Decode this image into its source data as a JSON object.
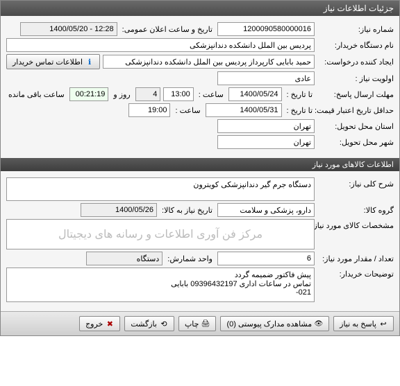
{
  "window": {
    "title": "جزئیات اطلاعات نیاز"
  },
  "need": {
    "number_label": "شماره نیاز:",
    "number": "1200090580000016",
    "announce_label": "تاریخ و ساعت اعلان عمومی:",
    "announce": "12:28 - 1400/05/20",
    "buyer_label": "نام دستگاه خریدار:",
    "buyer": "پردیس بین الملل دانشکده دندانپزشکی",
    "creator_label": "ایجاد کننده درخواست:",
    "creator": "حمید بابایی کارپرداز پردیس بین الملل دانشکده دندانپزشکی",
    "contact_btn": "اطلاعات تماس خریدار",
    "priority_label": "اولویت نیاز :",
    "priority": "عادی",
    "deadline_reply_label": "مهلت ارسال پاسخ:",
    "to_date_label": "تا تاریخ :",
    "deadline_date": "1400/05/24",
    "time_label": "ساعت :",
    "deadline_time": "13:00",
    "days": "4",
    "days_label": "روز و",
    "remain_time": "00:21:19",
    "remain_label": "ساعت باقی مانده",
    "min_valid_label": "حداقل تاریخ اعتبار قیمت:",
    "min_valid_date": "1400/05/31",
    "min_valid_time": "19:00",
    "province_label": "استان محل تحویل:",
    "province": "تهران",
    "city_label": "شهر محل تحویل:",
    "city": "تهران"
  },
  "goods_section": {
    "title": "اطلاعات کالاهای مورد نیاز"
  },
  "goods": {
    "desc_label": "شرح کلی نیاز:",
    "desc": "دستگاه جرم گیر دندانپزشکی کویترون",
    "group_label": "گروه کالا:",
    "group": "دارو، پزشکی و سلامت",
    "need_date_label": "تاریخ نیاز به کالا:",
    "need_date": "1400/05/26",
    "spec_label": "مشخصات کالای مورد نیاز:",
    "spec": "مرکز فن آوری اطلاعات و رسانه های دیجیتال",
    "qty_label": "تعداد / مقدار مورد نیاز:",
    "qty": "6",
    "unit_label": "واحد شمارش:",
    "unit": "دستگاه",
    "buyer_notes_label": "توضیحات خریدار:",
    "buyer_notes": "پیش فاکتور ضمیمه گردد\nتماس در ساعات اداری 09396432197 بابایی\n021-"
  },
  "buttons": {
    "reply": "پاسخ به نیاز",
    "attachments": "مشاهده مدارک پیوستی (0)",
    "print": "چاپ",
    "back": "بازگشت",
    "exit": "خروج"
  }
}
